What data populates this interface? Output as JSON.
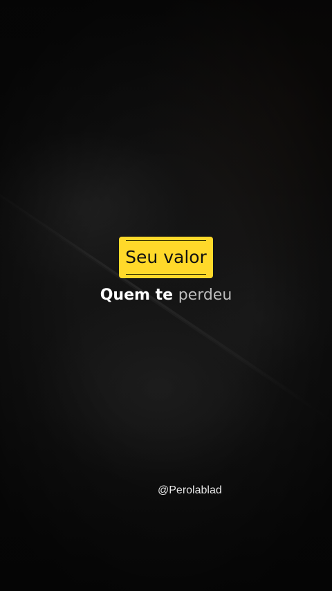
{
  "caption": {
    "highlight": "Seu valor",
    "line_main": "Quem te",
    "line_faded": "perdeu"
  },
  "watermark": {
    "handle": "@Perolablad"
  },
  "colors": {
    "highlight_bg": "#ffd92a",
    "highlight_text": "#111111",
    "caption_main": "#ffffff",
    "caption_faded": "#bdbdbd",
    "watermark": "#e6e6e6",
    "background": "#0d0d0d"
  }
}
